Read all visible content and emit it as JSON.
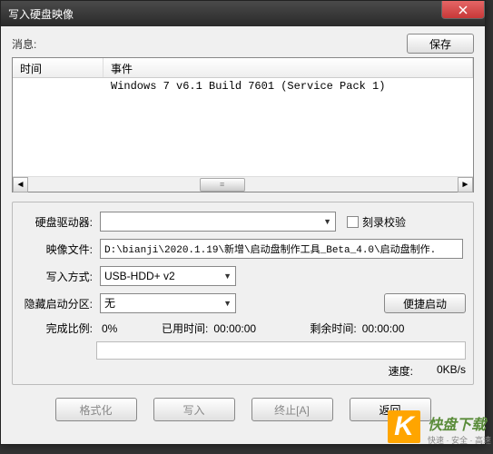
{
  "window": {
    "title": "写入硬盘映像"
  },
  "info": {
    "label": "消息:",
    "save_btn": "保存"
  },
  "listview": {
    "col_time": "时间",
    "col_event": "事件",
    "rows": [
      {
        "time": "",
        "event": "Windows 7 v6.1 Build 7601 (Service Pack 1)"
      }
    ]
  },
  "settings": {
    "drive_label": "硬盘驱动器:",
    "drive_value": "",
    "verify_label": "刻录校验",
    "image_label": "映像文件:",
    "image_value": "D:\\bianji\\2020.1.19\\新增\\启动盘制作工具_Beta_4.0\\启动盘制作.",
    "method_label": "写入方式:",
    "method_value": "USB-HDD+ v2",
    "hide_label": "隐藏启动分区:",
    "hide_value": "无",
    "quick_btn": "便捷启动"
  },
  "status": {
    "percent_label": "完成比例:",
    "percent_value": "0%",
    "elapsed_label": "已用时间:",
    "elapsed_value": "00:00:00",
    "remain_label": "剩余时间:",
    "remain_value": "00:00:00",
    "speed_label": "速度:",
    "speed_value": "0KB/s"
  },
  "buttons": {
    "format": "格式化",
    "write": "写入",
    "abort": "终止[A]",
    "back": "返回"
  },
  "watermark": {
    "main": "快盘下载",
    "sub": "快速 · 安全 · 高速"
  }
}
